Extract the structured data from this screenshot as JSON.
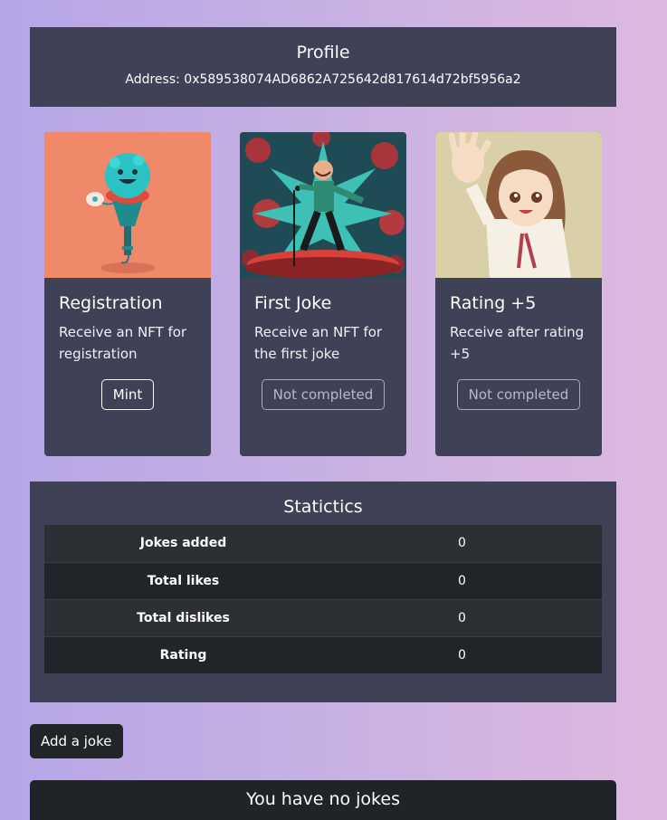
{
  "profile": {
    "title": "Profile",
    "address": "Address: 0x589538074AD6862A725642d817614d72bf5956a2"
  },
  "achievements": [
    {
      "title": "Registration",
      "description": "Receive an NFT for registration",
      "button_label": "Mint",
      "image": "microphone-mascot"
    },
    {
      "title": "First Joke",
      "description": "Receive an NFT for the first joke",
      "button_label": "Not completed",
      "image": "comedian-on-stage"
    },
    {
      "title": "Rating +5",
      "description": "Receive after rating +5",
      "button_label": "Not completed",
      "image": "anime-girl-waving"
    }
  ],
  "stats": {
    "title": "Statictics",
    "rows": [
      {
        "label": "Jokes added",
        "value": "0"
      },
      {
        "label": "Total likes",
        "value": "0"
      },
      {
        "label": "Total dislikes",
        "value": "0"
      },
      {
        "label": "Rating",
        "value": "0"
      }
    ]
  },
  "add_joke_label": "Add a joke",
  "jokes_section": {
    "title": "You have no jokes"
  },
  "colors": {
    "panel": "#3f4156",
    "dark": "#212529",
    "text": "#ffffff"
  }
}
